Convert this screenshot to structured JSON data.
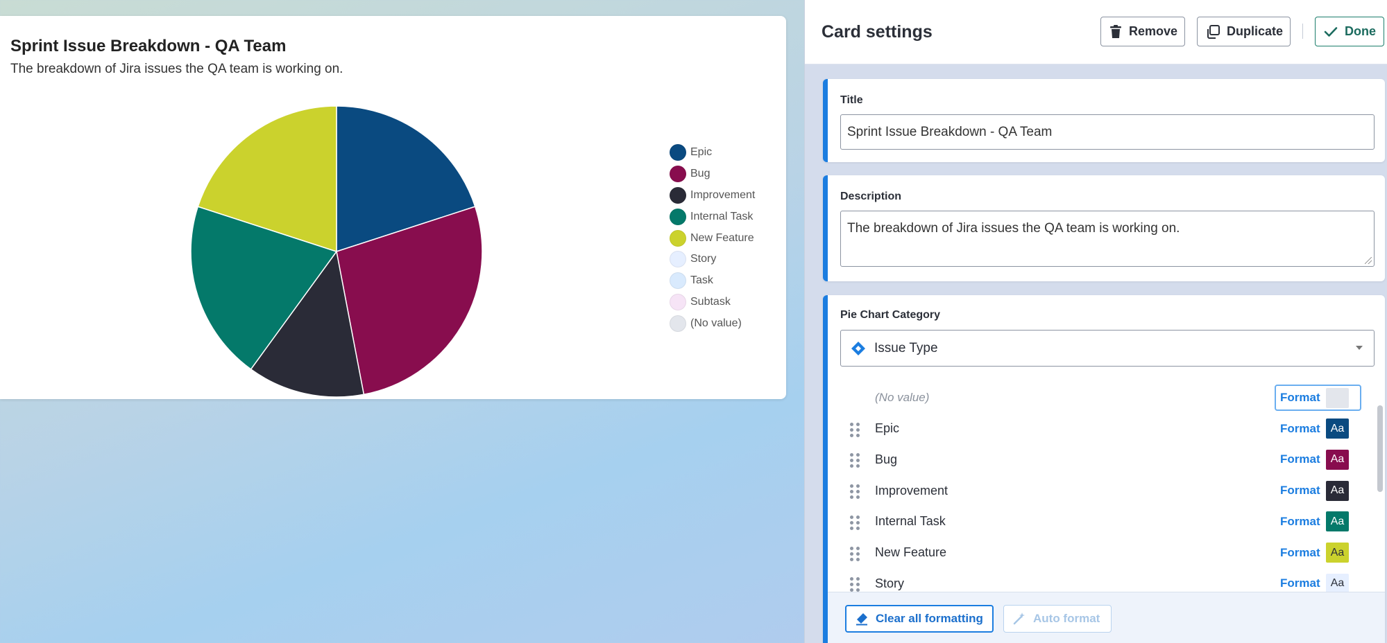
{
  "chart_card": {
    "title": "Sprint Issue Breakdown - QA Team",
    "subtitle": "The breakdown of Jira issues the QA team is working on."
  },
  "chart_data": {
    "type": "pie",
    "title": "Sprint Issue Breakdown - QA Team",
    "subtitle": "The breakdown of Jira issues the QA team is working on.",
    "categories": [
      "Epic",
      "Bug",
      "Improvement",
      "Internal Task",
      "New Feature",
      "Story",
      "Task",
      "Subtask",
      "(No value)"
    ],
    "values": [
      20,
      27,
      13,
      20,
      20,
      0,
      0,
      0,
      0
    ],
    "colors": [
      "#0a4a80",
      "#880d4e",
      "#2a2b37",
      "#04796a",
      "#cbd22d",
      "#e6efff",
      "#d9eafd",
      "#f6e4f6",
      "#e3e6ec"
    ],
    "legend": "right",
    "start_angle_deg": 0
  },
  "panel": {
    "title": "Card settings",
    "remove_label": "Remove",
    "duplicate_label": "Duplicate",
    "done_label": "Done",
    "title_section": {
      "label": "Title",
      "value": "Sprint Issue Breakdown - QA Team"
    },
    "description_section": {
      "label": "Description",
      "value": "The breakdown of Jira issues the QA team is working on."
    },
    "category_section": {
      "label": "Pie Chart Category",
      "selected": "Issue Type",
      "format_label": "Format",
      "swatch_text": "Aa",
      "rows": [
        {
          "label": "(No value)",
          "muted": true,
          "swatch_bg": "#e3e6ec",
          "swatch_fg": "#e3e6ec"
        },
        {
          "label": "Epic",
          "swatch_bg": "#0a4a80",
          "swatch_fg": "#ffffff"
        },
        {
          "label": "Bug",
          "swatch_bg": "#880d4e",
          "swatch_fg": "#ffffff"
        },
        {
          "label": "Improvement",
          "swatch_bg": "#2a2b37",
          "swatch_fg": "#ffffff"
        },
        {
          "label": "Internal Task",
          "swatch_bg": "#04796a",
          "swatch_fg": "#ffffff"
        },
        {
          "label": "New Feature",
          "swatch_bg": "#cbd22d",
          "swatch_fg": "#2b2f38"
        },
        {
          "label": "Story",
          "swatch_bg": "#e6efff",
          "swatch_fg": "#2b2f38"
        }
      ]
    },
    "footer": {
      "clear_label": "Clear all formatting",
      "auto_label": "Auto format"
    }
  }
}
